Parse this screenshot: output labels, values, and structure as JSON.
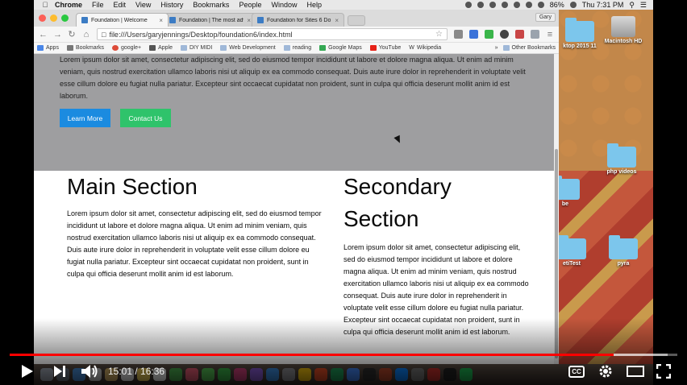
{
  "menubar": {
    "app": "Chrome",
    "items": [
      "File",
      "Edit",
      "View",
      "History",
      "Bookmarks",
      "People",
      "Window",
      "Help"
    ],
    "battery": "86%",
    "clock": "Thu 7:31 PM"
  },
  "desktop": {
    "icons": [
      "ktop 2015 11",
      "Macintosh HD",
      "php videos",
      "be",
      "etiTest",
      "pyra"
    ]
  },
  "browser": {
    "tabs": [
      {
        "title": "Foundation | Welcome",
        "active": true
      },
      {
        "title": "Foundation | The most adv",
        "active": false
      },
      {
        "title": "Foundation for Sites 6 Do",
        "active": false
      }
    ],
    "profile": "Gary",
    "url": "file:///Users/garyjennings/Desktop/foundation6/index.html",
    "bookmarks": [
      "Apps",
      "Bookmarks",
      "google+",
      "Apple",
      "DIY MIDI",
      "Web Development",
      "reading",
      "Google Maps",
      "YouTube",
      "Wikipedia"
    ],
    "other_bookmarks": "Other Bookmarks",
    "overflow": "»"
  },
  "page": {
    "hero_text": "Lorem ipsum dolor sit amet, consectetur adipiscing elit, sed do eiusmod tempor incididunt ut labore et dolore magna aliqua. Ut enim ad minim veniam, quis nostrud exercitation ullamco laboris nisi ut aliquip ex ea commodo consequat. Duis aute irure dolor in reprehenderit in voluptate velit esse cillum dolore eu fugiat nulla pariatur. Excepteur sint occaecat cupidatat non proident, sunt in culpa qui officia deserunt mollit anim id est laborum.",
    "learn_more": "Learn More",
    "contact_us": "Contact Us",
    "main_title": "Main Section",
    "main_text": "Lorem ipsum dolor sit amet, consectetur adipiscing elit, sed do eiusmod tempor incididunt ut labore et dolore magna aliqua. Ut enim ad minim veniam, quis nostrud exercitation ullamco laboris nisi ut aliquip ex ea commodo consequat. Duis aute irure dolor in reprehenderit in voluptate velit esse cillum dolore eu fugiat nulla pariatur. Excepteur sint occaecat cupidatat non proident, sunt in culpa qui officia deserunt mollit anim id est laborum.",
    "secondary_title": "Secondary Section",
    "secondary_text": "Lorem ipsum dolor sit amet, consectetur adipiscing elit, sed do eiusmod tempor incididunt ut labore et dolore magna aliqua. Ut enim ad minim veniam, quis nostrud exercitation ullamco laboris nisi ut aliquip ex ea commodo consequat. Duis aute irure dolor in reprehenderit in voluptate velit esse cillum dolore eu fugiat nulla pariatur. Excepteur sint occaecat cupidatat non proident, sunt in culpa qui officia deserunt mollit anim id est laborum."
  },
  "player": {
    "current_time": "15:01",
    "duration": "16:36",
    "progress_fraction": 0.904,
    "buffer_fraction": 0.985,
    "cc_label": "CC",
    "colors": {
      "progress": "#ff0000",
      "learn_more": "#1b8be0",
      "contact_us": "#2fc36b"
    }
  }
}
